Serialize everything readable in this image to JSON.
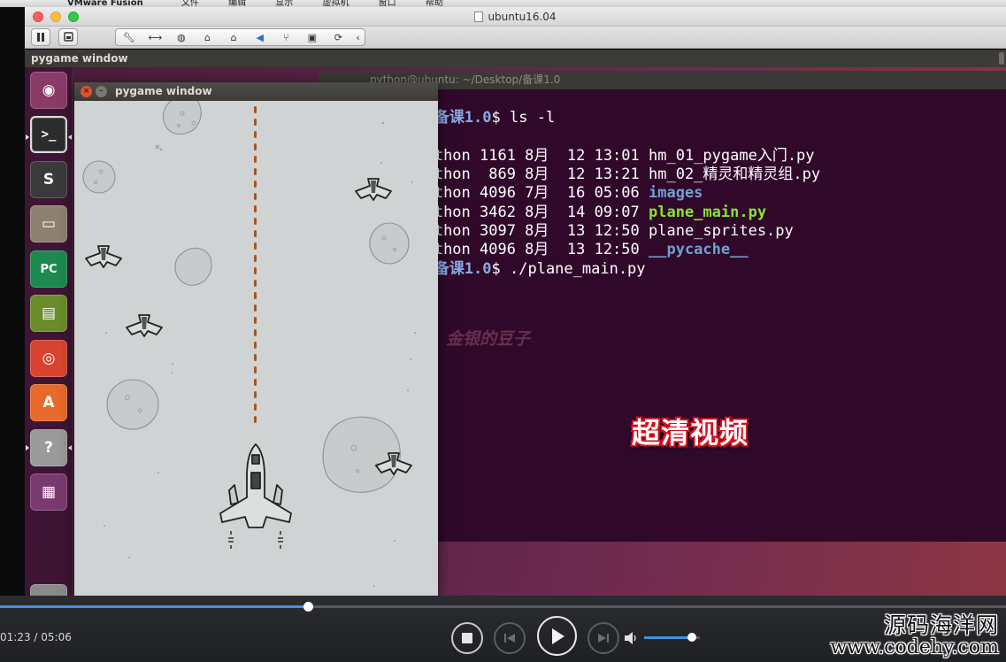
{
  "mac_menubar": {
    "app": "VMware Fusion",
    "items": [
      "文件",
      "编辑",
      "显示",
      "虚拟机",
      "窗口",
      "帮助"
    ]
  },
  "vm_window": {
    "title": "ubuntu16.04",
    "toolbar_icons": [
      "pause-icon",
      "snapshot-icon",
      "wrench-icon",
      "network-icon",
      "cd-icon",
      "lock-icon",
      "lock-icon",
      "volume-icon",
      "usb-icon",
      "disk-icon",
      "refresh-icon",
      "chevron-left-icon"
    ]
  },
  "ubuntu": {
    "top_bar_title": "pygame window",
    "launcher": [
      {
        "name": "ubuntu-dash-icon",
        "glyph": "◉",
        "bg": "#8a3a67"
      },
      {
        "name": "terminal-icon",
        "glyph": ">_",
        "bg": "#2c2c2c"
      },
      {
        "name": "sublime-text-icon",
        "glyph": "S",
        "bg": "#3a3a3a"
      },
      {
        "name": "files-icon",
        "glyph": "▭",
        "bg": "#8e8070"
      },
      {
        "name": "pycharm-icon",
        "glyph": "PC",
        "bg": "#1c8a4e"
      },
      {
        "name": "books-icon",
        "glyph": "▤",
        "bg": "#6a8c2a"
      },
      {
        "name": "chrome-icon",
        "glyph": "◎",
        "bg": "#d8442f"
      },
      {
        "name": "software-center-icon",
        "glyph": "A",
        "bg": "#e86a2a"
      },
      {
        "name": "help-icon",
        "glyph": "?",
        "bg": "#9a9a9a"
      },
      {
        "name": "workspace-switcher-icon",
        "glyph": "▦",
        "bg": "#7a3a70"
      }
    ]
  },
  "terminal": {
    "title": "python@ubuntu: ~/Desktop/备课1.0",
    "prompt_path": "u:~/Desktop/备课1.0",
    "cmd1": "$ ls -l",
    "listing": [
      {
        "meta": "python python 1161 8月  12 13:01 ",
        "name": "hm_01_pygame入门.py",
        "kind": "file"
      },
      {
        "meta": "python python  869 8月  12 13:21 ",
        "name": "hm_02_精灵和精灵组.py",
        "kind": "file"
      },
      {
        "meta": "python python 4096 7月  16 05:06 ",
        "name": "images",
        "kind": "dir"
      },
      {
        "meta": "python python 3462 8月  14 09:07 ",
        "name": "plane_main.py",
        "kind": "exe"
      },
      {
        "meta": "python python 3097 8月  13 12:50 ",
        "name": "plane_sprites.py",
        "kind": "file"
      },
      {
        "meta": "python python 4096 8月  13 12:50 ",
        "name": "__pycache__",
        "kind": "dir"
      }
    ],
    "cmd2": "$ ./plane_main.py",
    "watermark": "金银的豆子",
    "promo": "超清视频"
  },
  "pygame_window": {
    "title": "pygame window"
  },
  "player": {
    "timecode": "01:23 / 05:06",
    "progress": 0.3062,
    "volume": 0.85
  },
  "brand": {
    "line1": "源码海洋网",
    "line2": "www.codehy.com"
  }
}
